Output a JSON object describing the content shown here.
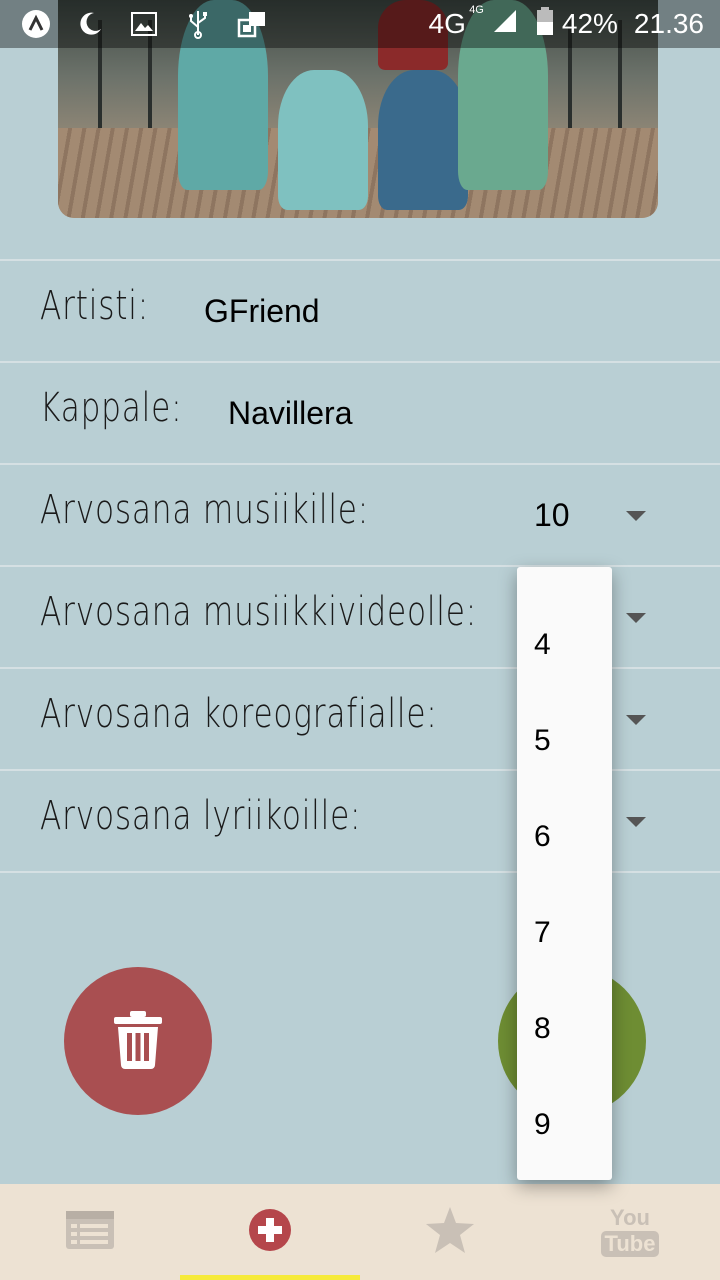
{
  "status_bar": {
    "network": "4G",
    "network_sup": "4G",
    "battery": "42%",
    "time": "21.36"
  },
  "form": {
    "artist_label": "Artisti:",
    "artist_value": "GFriend",
    "song_label": "Kappale:",
    "song_value": "Navillera",
    "music_label": "Arvosana musiikille:",
    "music_value": "10",
    "video_label": "Arvosana musiikkivideolle:",
    "choreo_label": "Arvosana koreografialle:",
    "lyrics_label": "Arvosana lyriikoille:"
  },
  "dropdown": {
    "options": [
      "4",
      "5",
      "6",
      "7",
      "8",
      "9"
    ]
  },
  "bottom_nav": {
    "youtube_top": "You",
    "youtube_bottom": "Tube",
    "active_color": "#f6ea3a"
  },
  "colors": {
    "background": "#b9cfd4",
    "delete_fab": "#a94f51",
    "ok_fab": "#6e8d33",
    "nav_bg": "#ede2d3"
  },
  "icons": {
    "list": "list-icon",
    "add": "plus-circle-icon",
    "favorites": "star-icon",
    "youtube": "youtube-icon",
    "delete": "trash-icon"
  }
}
